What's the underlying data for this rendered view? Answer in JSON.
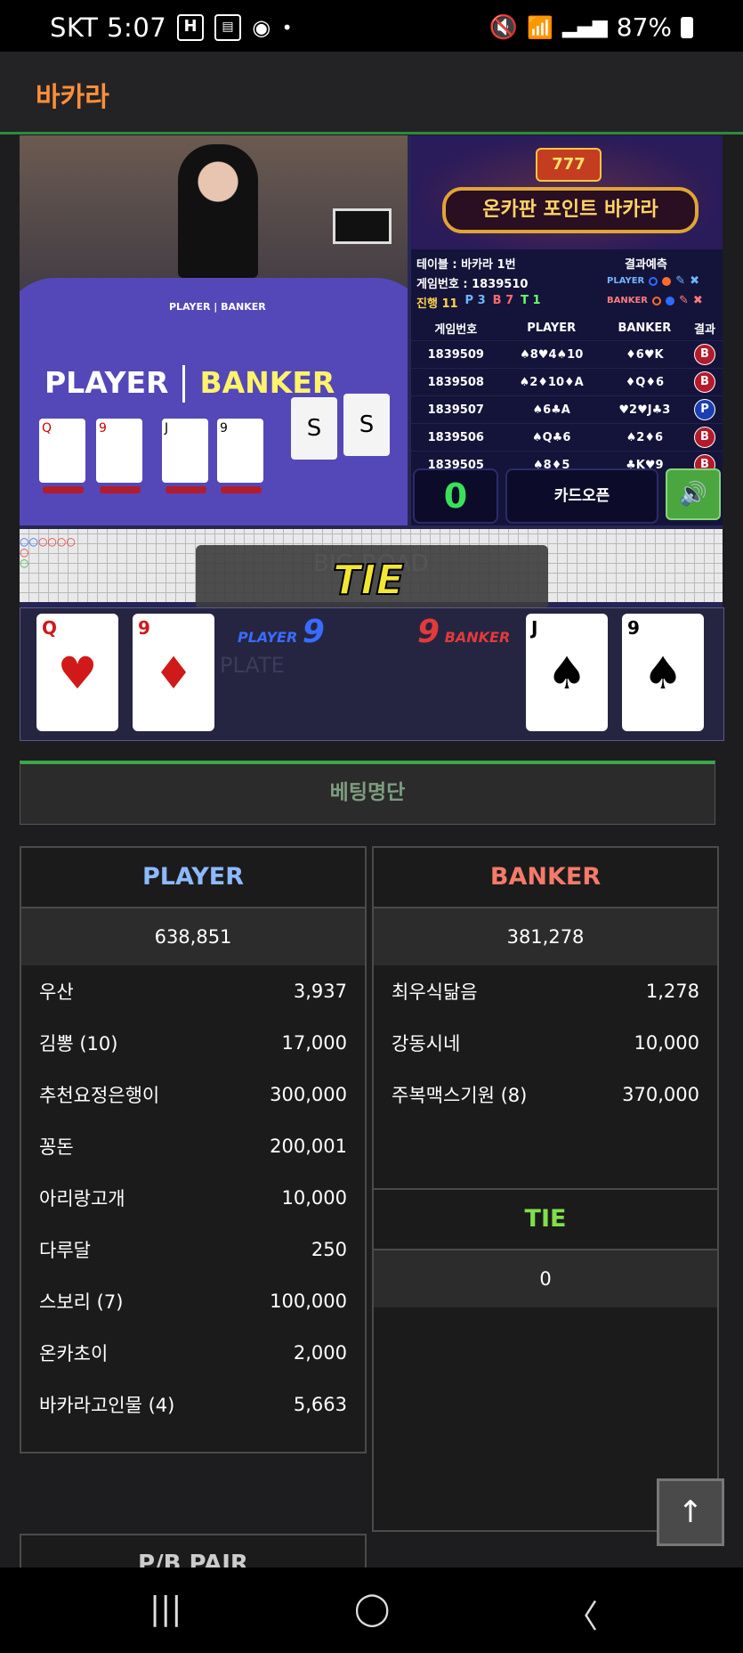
{
  "status": {
    "carrier_time": "SKT 5:07",
    "battery": "87%"
  },
  "app": {
    "title": "바카라"
  },
  "video": {
    "player_label": "PLAYER",
    "banker_label": "BANKER",
    "cardbox_text": "0"
  },
  "banner": {
    "slot": "777",
    "title": "온카판 포인트 바카라"
  },
  "table_info": {
    "table": "테이블 : 바카라 1번",
    "game_no": "게임번호 : 1839510",
    "progress_label": "진행 11",
    "p_count": "P 3",
    "b_count": "B 7",
    "t_count": "T 1",
    "predict_label": "결과예측",
    "predict_player": "PLAYER",
    "predict_banker": "BANKER"
  },
  "history": {
    "headers": [
      "게임번호",
      "PLAYER",
      "BANKER",
      "결과"
    ],
    "rows": [
      {
        "game": "1839509",
        "player": "♠8♥4♠10",
        "banker": "♦6♥K",
        "result": "B"
      },
      {
        "game": "1839508",
        "player": "♠2♦10♦A",
        "banker": "♦Q♦6",
        "result": "B"
      },
      {
        "game": "1839507",
        "player": "♠6♣A",
        "banker": "♥2♥J♣3",
        "result": "P"
      },
      {
        "game": "1839506",
        "player": "♠Q♣6",
        "banker": "♠2♦6",
        "result": "B"
      },
      {
        "game": "1839505",
        "player": "♠8♦5",
        "banker": "♣K♥9",
        "result": "B"
      }
    ]
  },
  "controls": {
    "counter": "0",
    "card_open": "카드오픈",
    "sound_icon": "🔊"
  },
  "road": {
    "ghost_text": "BIG ROAD",
    "result_banner": "TIE",
    "ghost_plate": "PLATE"
  },
  "reveal": {
    "player_label": "PLAYER",
    "player_score": "9",
    "banker_label": "BANKER",
    "banker_score": "9",
    "player_cards": [
      {
        "rank": "Q",
        "suit": "♥"
      },
      {
        "rank": "9",
        "suit": "♦"
      }
    ],
    "banker_cards": [
      {
        "rank": "J",
        "suit": "♠"
      },
      {
        "rank": "9",
        "suit": "♠"
      }
    ]
  },
  "bet_list": {
    "title": "베팅명단",
    "player": {
      "label": "PLAYER",
      "total": "638,851",
      "color": "#8db9ff",
      "entries": [
        {
          "name": "우산",
          "amount": "3,937"
        },
        {
          "name": "김뽕 (10)",
          "amount": "17,000"
        },
        {
          "name": "추천요정은행이",
          "amount": "300,000"
        },
        {
          "name": "꽁돈",
          "amount": "200,001"
        },
        {
          "name": "아리랑고개",
          "amount": "10,000"
        },
        {
          "name": "다루달",
          "amount": "250"
        },
        {
          "name": "스보리 (7)",
          "amount": "100,000"
        },
        {
          "name": "온카초이",
          "amount": "2,000"
        },
        {
          "name": "바카라고인물 (4)",
          "amount": "5,663"
        }
      ]
    },
    "banker": {
      "label": "BANKER",
      "total": "381,278",
      "color": "#f47a6a",
      "entries": [
        {
          "name": "최우식닮음",
          "amount": "1,278"
        },
        {
          "name": "강동시네",
          "amount": "10,000"
        },
        {
          "name": "주복맥스기원 (8)",
          "amount": "370,000"
        }
      ]
    },
    "tie": {
      "label": "TIE",
      "total": "0",
      "color": "#7fe04a"
    },
    "pb_pair": {
      "label": "P/B PAIR"
    }
  },
  "scroll_top": "↑",
  "nav": {
    "recent": "|||",
    "home": "◯",
    "back": "〈"
  }
}
